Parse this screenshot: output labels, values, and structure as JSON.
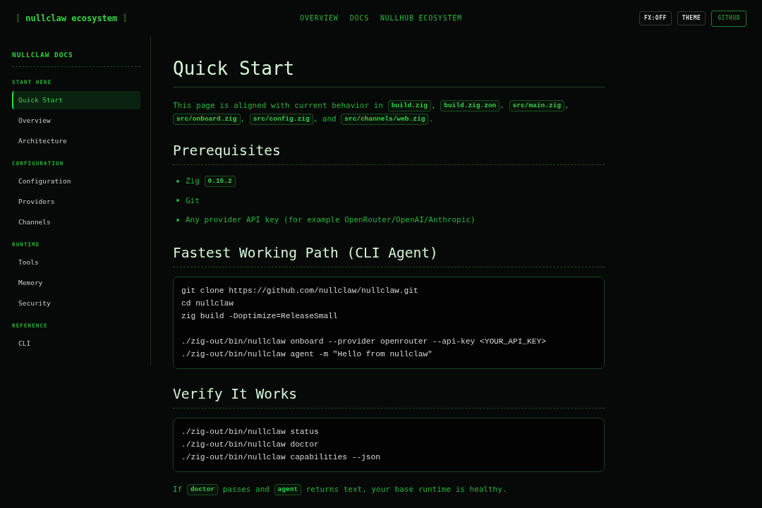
{
  "header": {
    "logo": {
      "open": "[",
      "name": "nullclaw ecosystem",
      "close": "]"
    },
    "nav": [
      {
        "label": "OVERVIEW"
      },
      {
        "label": "DOCS"
      },
      {
        "label": "NULLHUB ECOSYSTEM"
      }
    ],
    "buttons": [
      {
        "label": "FX:OFF",
        "kind": "toggle"
      },
      {
        "label": "THEME",
        "kind": "toggle"
      },
      {
        "label": "GITHUB",
        "kind": "link"
      }
    ]
  },
  "sidebar": {
    "title": "NULLCLAW DOCS",
    "sections": [
      {
        "heading": "START HERE",
        "items": [
          {
            "label": "Quick Start",
            "selected": true
          },
          {
            "label": "Overview",
            "selected": false
          },
          {
            "label": "Architecture",
            "selected": false
          }
        ]
      },
      {
        "heading": "CONFIGURATION",
        "items": [
          {
            "label": "Configuration",
            "selected": false
          },
          {
            "label": "Providers",
            "selected": false
          },
          {
            "label": "Channels",
            "selected": false
          }
        ]
      },
      {
        "heading": "RUNTIME",
        "items": [
          {
            "label": "Tools",
            "selected": false
          },
          {
            "label": "Memory",
            "selected": false
          },
          {
            "label": "Security",
            "selected": false
          }
        ]
      },
      {
        "heading": "REFERENCE",
        "items": [
          {
            "label": "CLI",
            "selected": false
          }
        ]
      }
    ]
  },
  "content": {
    "title": "Quick Start",
    "blocks": [
      {
        "kind": "paragraph",
        "parts": [
          {
            "kind": "text",
            "text": "This page is aligned with current behavior in "
          },
          {
            "kind": "code",
            "text": "build.zig"
          },
          {
            "kind": "text",
            "text": ", "
          },
          {
            "kind": "code",
            "text": "build.zig.zon"
          },
          {
            "kind": "text",
            "text": ", "
          },
          {
            "kind": "code",
            "text": "src/main.zig"
          },
          {
            "kind": "text",
            "text": ", "
          },
          {
            "kind": "code",
            "text": "src/onboard.zig"
          },
          {
            "kind": "text",
            "text": ", "
          },
          {
            "kind": "code",
            "text": "src/config.zig"
          },
          {
            "kind": "text",
            "text": ", and "
          },
          {
            "kind": "code",
            "text": "src/channels/web.zig"
          },
          {
            "kind": "text",
            "text": "."
          }
        ]
      },
      {
        "kind": "heading",
        "text": "Prerequisites"
      },
      {
        "kind": "list",
        "items": [
          {
            "parts": [
              {
                "kind": "text",
                "text": "Zig "
              },
              {
                "kind": "code",
                "text": "0.15.2"
              }
            ]
          },
          {
            "parts": [
              {
                "kind": "text",
                "text": "Git"
              }
            ]
          },
          {
            "parts": [
              {
                "kind": "text",
                "text": "Any provider API key (for example OpenRouter/OpenAI/Anthropic)"
              }
            ]
          }
        ]
      },
      {
        "kind": "heading",
        "text": "Fastest Working Path (CLI Agent)"
      },
      {
        "kind": "code",
        "groups": [
          [
            "git clone https://github.com/nullclaw/nullclaw.git",
            "cd nullclaw",
            "zig build -Doptimize=ReleaseSmall"
          ],
          [
            "./zig-out/bin/nullclaw onboard --provider openrouter --api-key <YOUR_API_KEY>",
            "./zig-out/bin/nullclaw agent -m \"Hello from nullclaw\""
          ]
        ]
      },
      {
        "kind": "heading",
        "text": "Verify It Works"
      },
      {
        "kind": "code",
        "groups": [
          [
            "./zig-out/bin/nullclaw status",
            "./zig-out/bin/nullclaw doctor",
            "./zig-out/bin/nullclaw capabilities --json"
          ]
        ]
      },
      {
        "kind": "paragraph",
        "parts": [
          {
            "kind": "text",
            "text": "If "
          },
          {
            "kind": "code",
            "text": "doctor"
          },
          {
            "kind": "text",
            "text": " passes and "
          },
          {
            "kind": "code",
            "text": "agent"
          },
          {
            "kind": "text",
            "text": " returns text, your base runtime is healthy."
          }
        ]
      }
    ]
  }
}
